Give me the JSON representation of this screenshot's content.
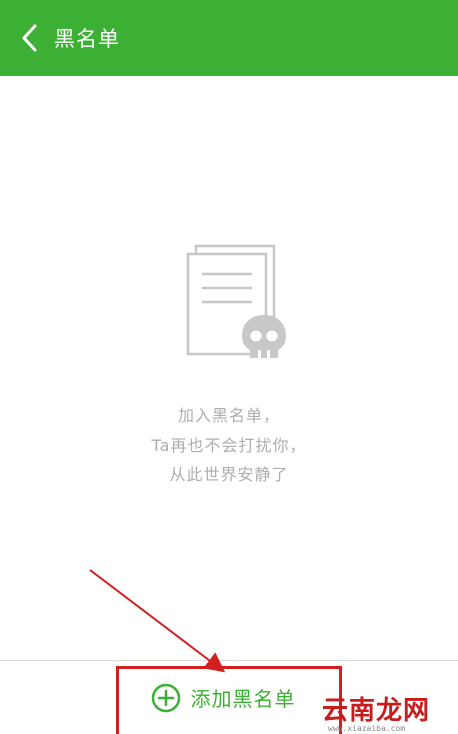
{
  "header": {
    "title": "黑名单",
    "back_icon": "chevron-left-icon",
    "background_color": "#3cb034"
  },
  "empty_state": {
    "illustration_icon": "document-skull-icon",
    "lines": [
      "加入黑名单，",
      "Ta再也不会打扰你，",
      "从此世界安静了"
    ],
    "text_color": "#aeaeae"
  },
  "bottom_bar": {
    "add_label": "添加黑名单",
    "add_icon": "plus-circle-icon",
    "accent_color": "#3cb034"
  },
  "annotation": {
    "highlight_color": "#d21f1f"
  },
  "watermark": {
    "text": "云南龙网",
    "url": "www.xiazaiba.com"
  }
}
